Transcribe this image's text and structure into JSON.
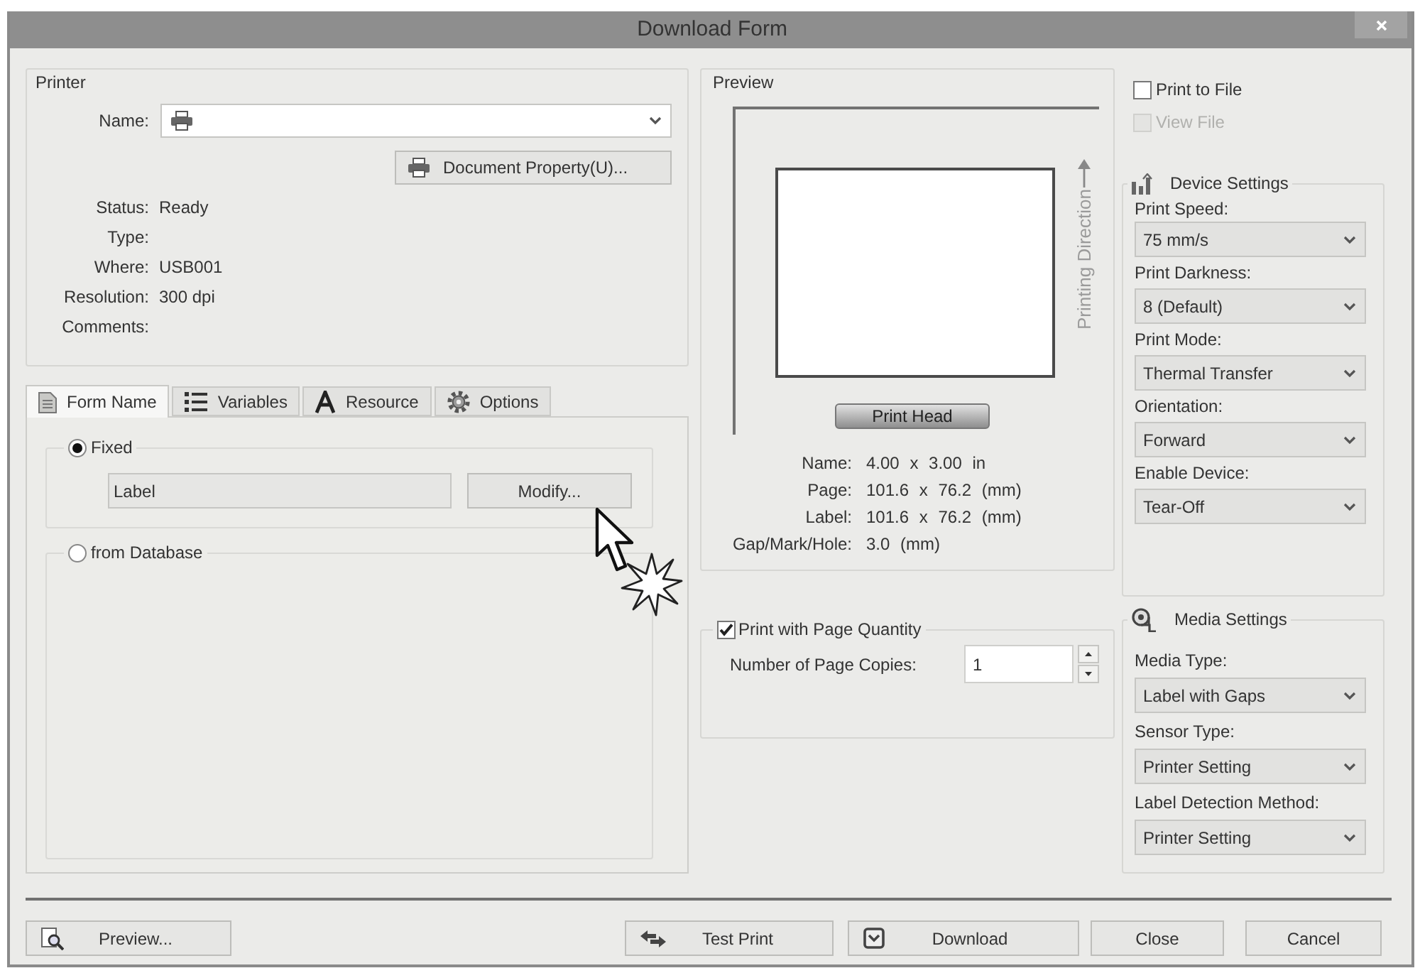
{
  "window": {
    "title": "Download Form"
  },
  "printer": {
    "title": "Printer",
    "name_label": "Name:",
    "document_property_button": "Document Property(U)...",
    "info": [
      {
        "label": "Status:",
        "value": "Ready"
      },
      {
        "label": "Type:"
      },
      {
        "label": "Where:",
        "value": "USB001"
      },
      {
        "label": "Resolution:",
        "value": "300 dpi"
      },
      {
        "label": "Comments:"
      }
    ]
  },
  "tabs": [
    {
      "label": "Form Name",
      "selected": true
    },
    {
      "label": "Variables",
      "selected": false
    },
    {
      "label": "Resource",
      "selected": false
    },
    {
      "label": "Options",
      "selected": false
    }
  ],
  "form_name": {
    "sources": [
      {
        "label": "Fixed",
        "selected": true,
        "value": "Label",
        "button": "Modify..."
      },
      {
        "label": "from Database",
        "selected": false
      }
    ]
  },
  "preview": {
    "title": "Preview",
    "direction_label": "Printing Direction",
    "print_head": "Print Head",
    "info": [
      {
        "label": "Name:",
        "value": "4.00 x 3.00 in"
      },
      {
        "label": "Page:",
        "value": "101.6 x 76.2 (mm)"
      },
      {
        "label": "Label:",
        "value": "101.6 x 76.2 (mm)"
      },
      {
        "label": "Gap/Mark/Hole:",
        "value": "3.0 (mm)"
      }
    ]
  },
  "page_quantity": {
    "label": "Print with Page Quantity",
    "checked": true,
    "copies_label": "Number of Page Copies:",
    "copies": "1"
  },
  "output": [
    {
      "label": "Print to File",
      "checked": false,
      "disabled": false
    },
    {
      "label": "View File",
      "checked": false,
      "disabled": true
    }
  ],
  "device_settings": {
    "title": "Device Settings",
    "fields": [
      {
        "label": "Print Speed:",
        "value": "75 mm/s"
      },
      {
        "label": "Print Darkness:",
        "value": "8 (Default)"
      },
      {
        "label": "Print Mode:",
        "value": "Thermal Transfer"
      },
      {
        "label": "Orientation:",
        "value": "Forward"
      },
      {
        "label": "Enable Device:",
        "value": "Tear-Off"
      }
    ]
  },
  "media_settings": {
    "title": "Media Settings",
    "fields": [
      {
        "label": "Media Type:",
        "value": "Label with Gaps"
      },
      {
        "label": "Sensor Type:",
        "value": "Printer Setting"
      },
      {
        "label": "Label Detection Method:",
        "value": "Printer Setting"
      }
    ]
  },
  "buttons": [
    {
      "label": "Preview..."
    },
    {
      "label": "Test Print"
    },
    {
      "label": "Download"
    },
    {
      "label": "Close"
    },
    {
      "label": "Cancel"
    }
  ]
}
